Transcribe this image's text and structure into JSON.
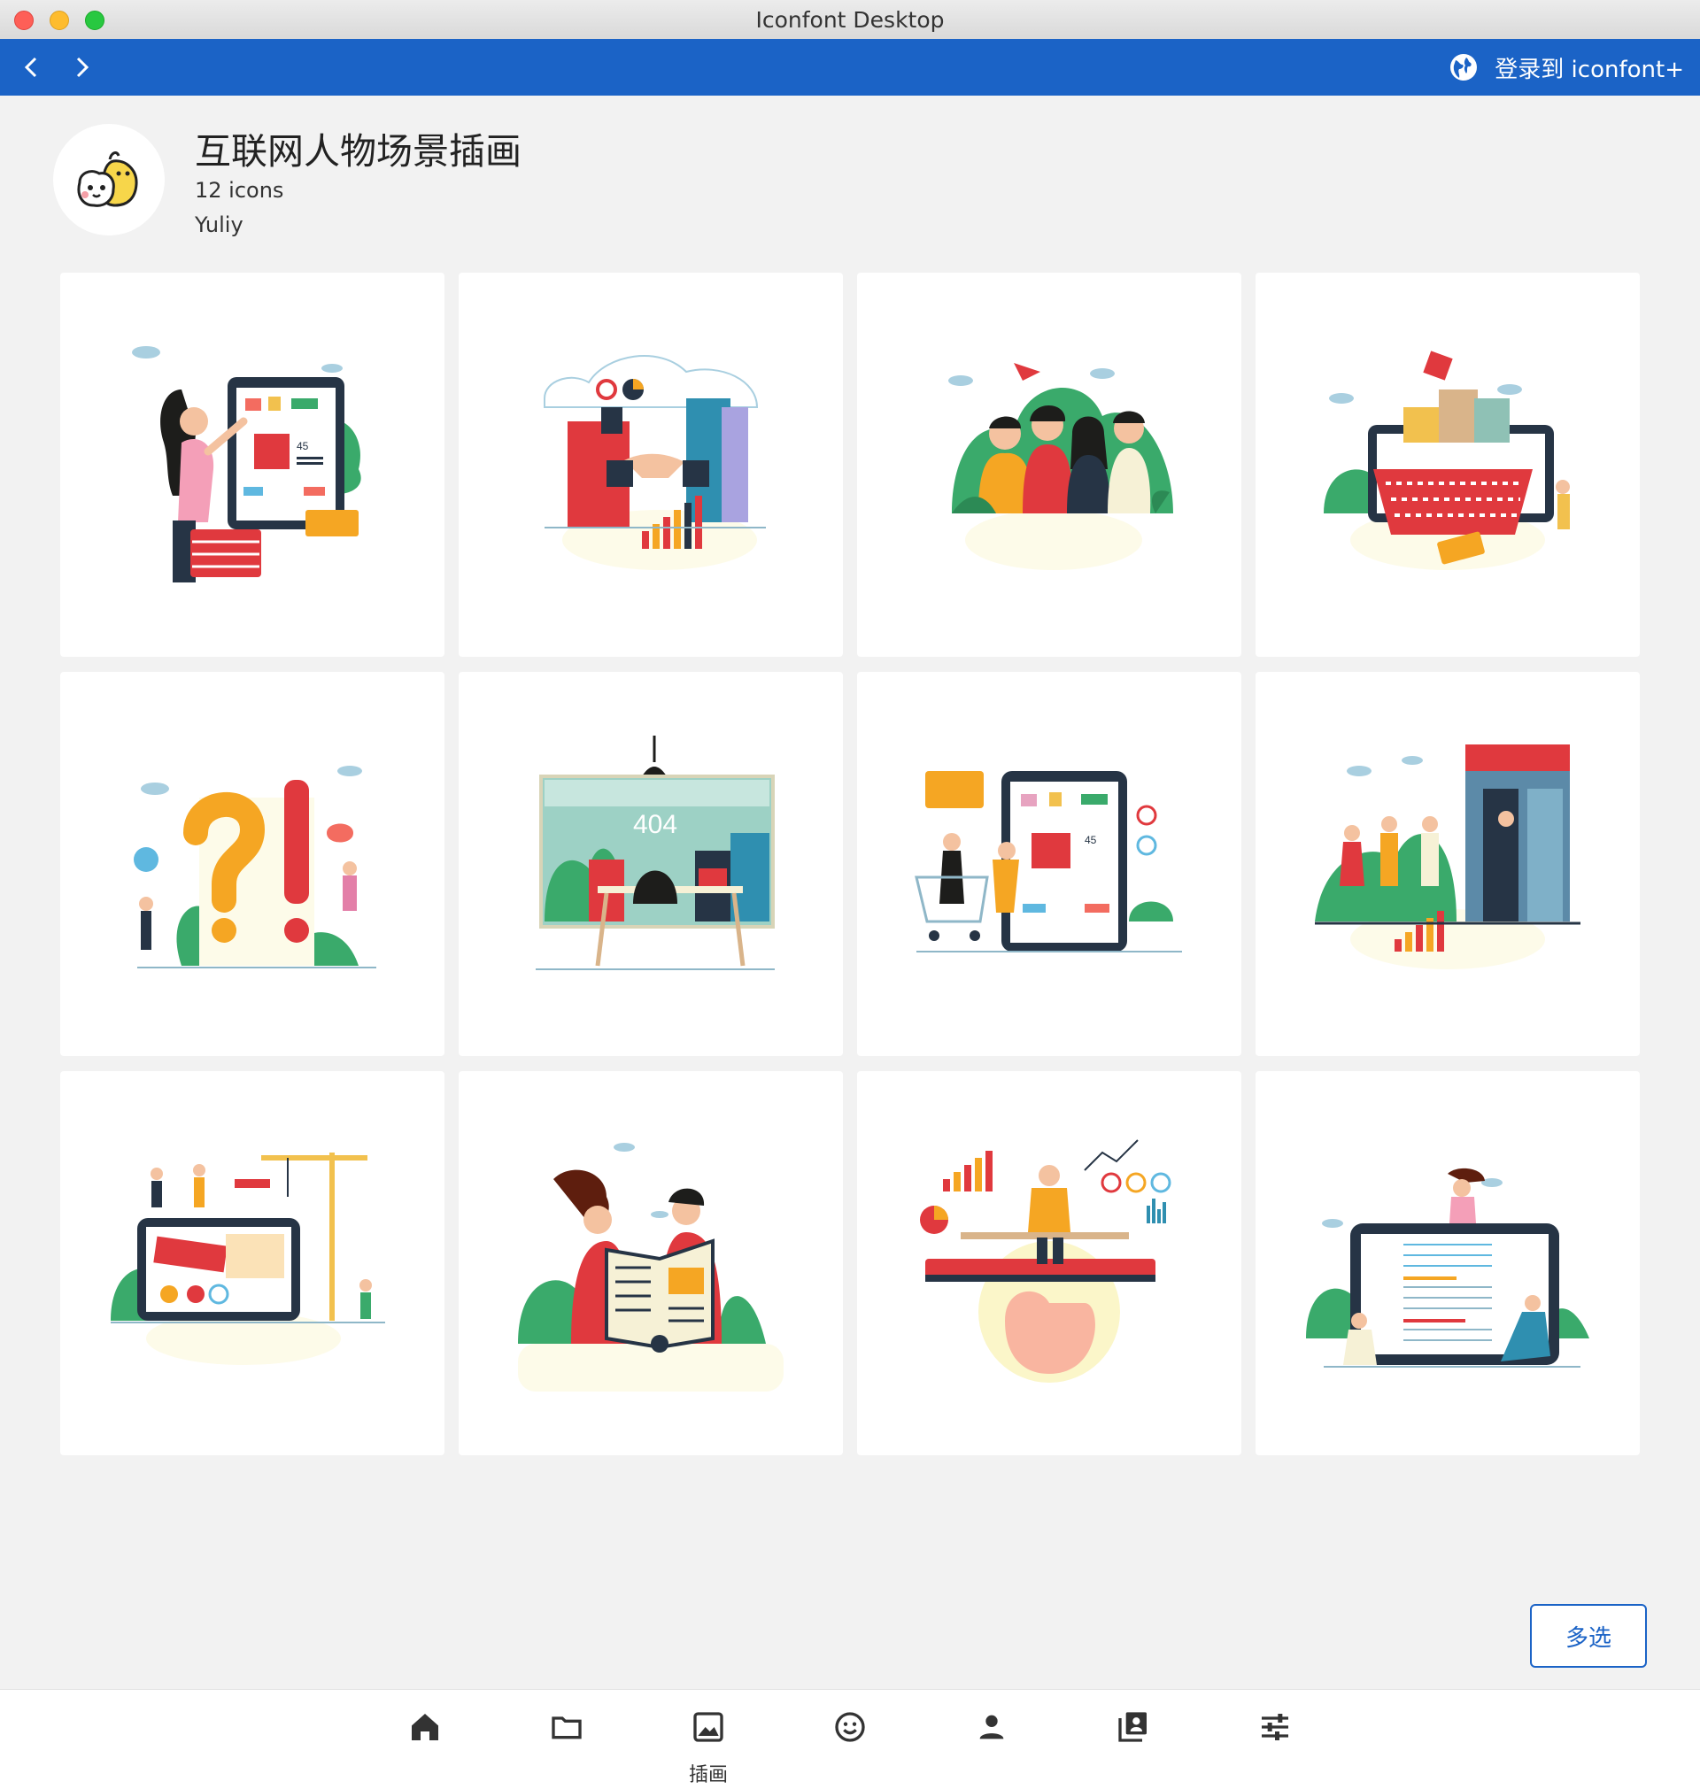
{
  "window": {
    "title": "Iconfont Desktop"
  },
  "toolbar": {
    "login_label": "登录到 iconfont+"
  },
  "library": {
    "title": "互联网人物场景插画",
    "count": "12 icons",
    "author": "Yuliy"
  },
  "illustrations": [
    {
      "name": "online-shopping-woman-basket"
    },
    {
      "name": "business-handshake-city"
    },
    {
      "name": "team-group-portrait"
    },
    {
      "name": "shopping-basket-boxes"
    },
    {
      "name": "question-exclamation"
    },
    {
      "name": "error-404-desk"
    },
    {
      "name": "mobile-shopping-cart"
    },
    {
      "name": "shop-door-queue"
    },
    {
      "name": "website-construction-crane"
    },
    {
      "name": "couple-reading-newspaper"
    },
    {
      "name": "data-analysis-hand"
    },
    {
      "name": "tablet-reading-people"
    }
  ],
  "actions": {
    "multi_select": "多选"
  },
  "bottom_nav": [
    {
      "icon": "home-icon"
    },
    {
      "icon": "folder-icon"
    },
    {
      "icon": "image-icon",
      "label": "插画",
      "active": true
    },
    {
      "icon": "emoji-icon"
    },
    {
      "icon": "person-icon"
    },
    {
      "icon": "collection-icon"
    },
    {
      "icon": "settings-sliders-icon"
    }
  ]
}
